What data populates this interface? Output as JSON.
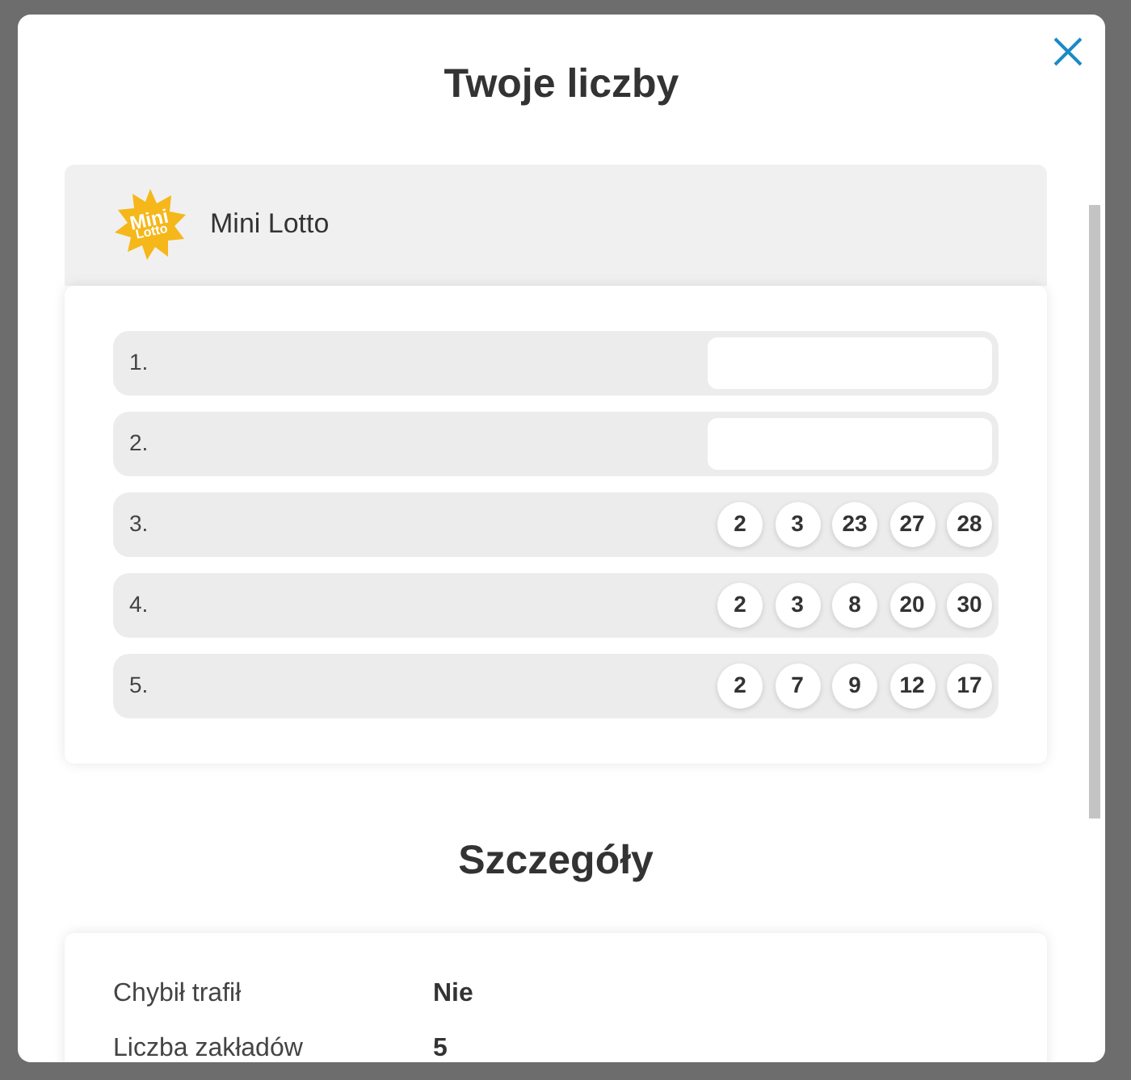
{
  "dialog": {
    "title": "Twoje liczby"
  },
  "game": {
    "name": "Mini Lotto",
    "logo_text": [
      "Mini",
      "Lotto"
    ]
  },
  "bets": [
    {
      "label": "1.",
      "redacted": true
    },
    {
      "label": "2.",
      "redacted": true
    },
    {
      "label": "3.",
      "redacted": false,
      "numbers": [
        "2",
        "3",
        "23",
        "27",
        "28"
      ]
    },
    {
      "label": "4.",
      "redacted": false,
      "numbers": [
        "2",
        "3",
        "8",
        "20",
        "30"
      ]
    },
    {
      "label": "5.",
      "redacted": false,
      "numbers": [
        "2",
        "7",
        "9",
        "12",
        "17"
      ]
    }
  ],
  "details": {
    "title": "Szczegóły",
    "rows": [
      {
        "label": "Chybił trafił",
        "value": "Nie"
      },
      {
        "label": "Liczba zakładów",
        "value": "5"
      }
    ]
  }
}
